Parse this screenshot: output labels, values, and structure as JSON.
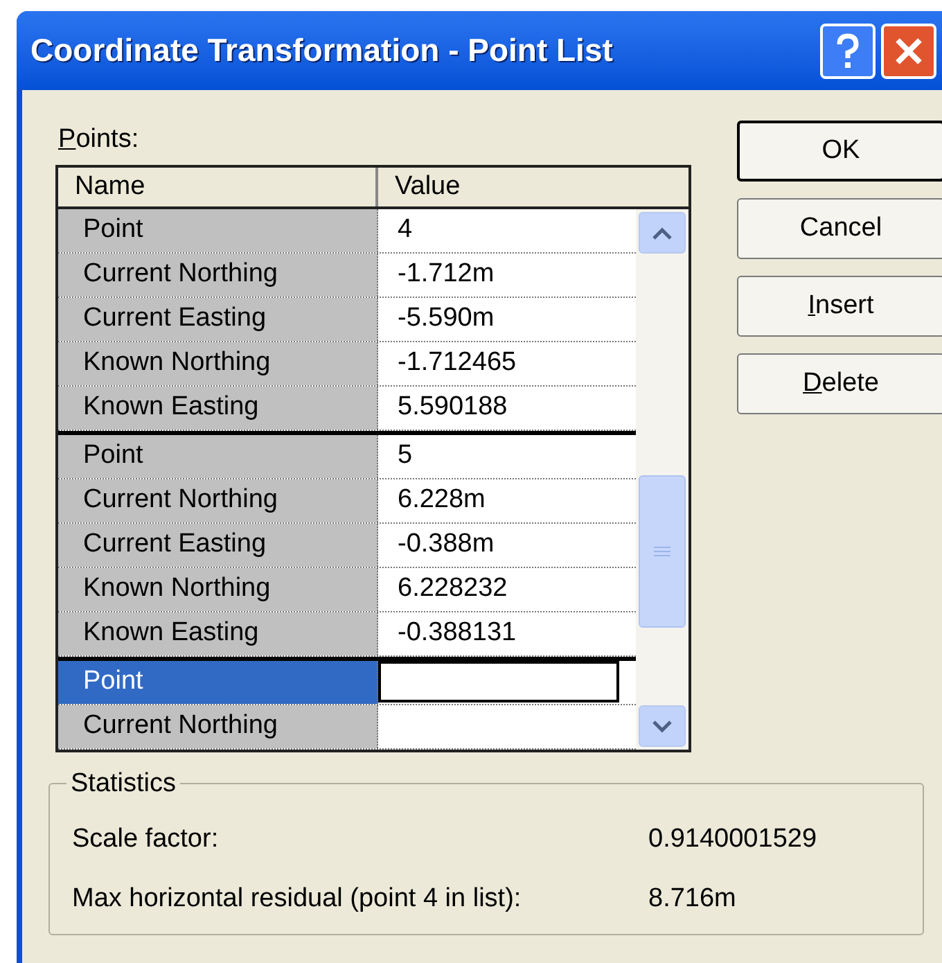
{
  "window": {
    "title": "Coordinate Transformation - Point List"
  },
  "points_label": {
    "mnemonic": "P",
    "rest": "oints:"
  },
  "grid": {
    "columns": [
      "Name",
      "Value"
    ],
    "groups": [
      {
        "rows": [
          {
            "name": "Point",
            "value": "4",
            "selected": false
          },
          {
            "name": "Current Northing",
            "value": "-1.712m",
            "selected": false
          },
          {
            "name": "Current Easting",
            "value": "-5.590m",
            "selected": false
          },
          {
            "name": "Known Northing",
            "value": "-1.712465",
            "selected": false
          },
          {
            "name": "Known Easting",
            "value": "5.590188",
            "selected": false
          }
        ]
      },
      {
        "rows": [
          {
            "name": "Point",
            "value": "5",
            "selected": false
          },
          {
            "name": "Current Northing",
            "value": "6.228m",
            "selected": false
          },
          {
            "name": "Current Easting",
            "value": "-0.388m",
            "selected": false
          },
          {
            "name": "Known Northing",
            "value": "6.228232",
            "selected": false
          },
          {
            "name": "Known Easting",
            "value": "-0.388131",
            "selected": false
          }
        ]
      },
      {
        "rows": [
          {
            "name": "Point",
            "selected": true
          },
          {
            "name": "Current Northing",
            "selected": false
          }
        ]
      }
    ]
  },
  "buttons": [
    {
      "label": "OK",
      "default": true
    },
    {
      "label": "Cancel",
      "default": false
    },
    {
      "mnemonic": "I",
      "rest": "nsert",
      "default": false
    },
    {
      "mnemonic": "D",
      "rest": "elete",
      "default": false
    }
  ],
  "statistics": {
    "title": "Statistics",
    "rows": [
      {
        "label": "Scale factor:",
        "value": "0.9140001529"
      },
      {
        "label": "Max horizontal residual (point 4 in list):",
        "value": "8.716m"
      }
    ]
  }
}
